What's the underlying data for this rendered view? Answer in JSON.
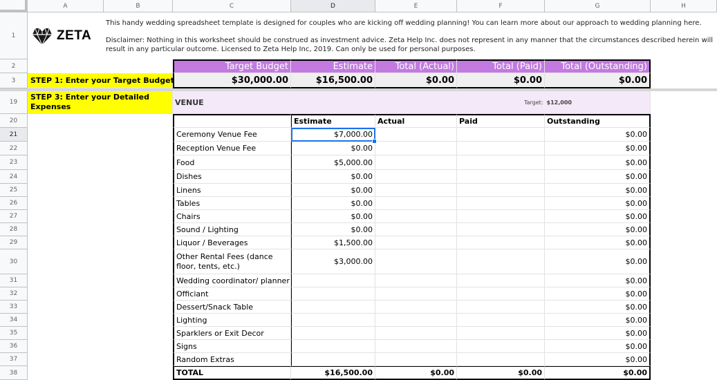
{
  "columns": [
    "A",
    "B",
    "C",
    "D",
    "E",
    "F",
    "G",
    "H"
  ],
  "selected_column": "D",
  "rows": [
    "1",
    "2",
    "3",
    "19",
    "20",
    "21",
    "22",
    "23",
    "24",
    "25",
    "26",
    "27",
    "28",
    "29",
    "30",
    "31",
    "32",
    "33",
    "34",
    "35",
    "36",
    "37",
    "38"
  ],
  "selected_row": "21",
  "logo": {
    "icon": "heart-gem-icon",
    "text": "ZETA"
  },
  "intro_line": "This handy wedding spreadsheet template is designed for couples who are kicking off wedding planning! You can learn more about our approach to wedding planning here.",
  "disclaimer_line1": "Disclaimer: Nothing in this worksheet should be construed as investment advice. Zeta Help Inc. does not represent in any manner that the circumstances described herein will",
  "disclaimer_line2": "result in any particular outcome. Licensed to Zeta Help Inc, 2019. Can only be used for personal purposes.",
  "budget_header": {
    "target": "Target Budget",
    "estimate": "Estimate",
    "total_actual": "Total (Actual)",
    "total_paid": "Total (Paid)",
    "total_outstanding": "Total (Outstanding)"
  },
  "budget_values": {
    "target": "$30,000.00",
    "estimate": "$16,500.00",
    "total_actual": "$0.00",
    "total_paid": "$0.00",
    "total_outstanding": "$0.00"
  },
  "step1_label": "STEP 1: Enter your Target Budget",
  "step3_label": "STEP 3: Enter your Detailed Expenses",
  "section": {
    "title": "VENUE",
    "target_label": "Target:",
    "target_value": "$12,000"
  },
  "table_headers": {
    "estimate": "Estimate",
    "actual": "Actual",
    "paid": "Paid",
    "outstanding": "Outstanding"
  },
  "items": [
    {
      "name": "Ceremony Venue Fee",
      "estimate": "$7,000.00",
      "outstanding": "$0.00"
    },
    {
      "name": "Reception Venue Fee",
      "estimate": "$0.00",
      "outstanding": "$0.00"
    },
    {
      "name": "Food",
      "estimate": "$5,000.00",
      "outstanding": "$0.00"
    },
    {
      "name": "Dishes",
      "estimate": "$0.00",
      "outstanding": "$0.00"
    },
    {
      "name": "Linens",
      "estimate": "$0.00",
      "outstanding": "$0.00"
    },
    {
      "name": "Tables",
      "estimate": "$0.00",
      "outstanding": "$0.00"
    },
    {
      "name": "Chairs",
      "estimate": "$0.00",
      "outstanding": "$0.00"
    },
    {
      "name": "Sound / Lighting",
      "estimate": "$0.00",
      "outstanding": "$0.00"
    },
    {
      "name": "Liquor / Beverages",
      "estimate": "$1,500.00",
      "outstanding": "$0.00"
    },
    {
      "name": "Other Rental Fees (dance",
      "name2": "floor, tents, etc.)",
      "estimate": "$3,000.00",
      "outstanding": "$0.00"
    },
    {
      "name": "Wedding coordinator/ planner",
      "estimate": "",
      "outstanding": "$0.00"
    },
    {
      "name": "Officiant",
      "estimate": "",
      "outstanding": "$0.00"
    },
    {
      "name": "Dessert/Snack Table",
      "estimate": "",
      "outstanding": "$0.00"
    },
    {
      "name": "Lighting",
      "estimate": "",
      "outstanding": "$0.00"
    },
    {
      "name": "Sparklers or Exit Decor",
      "estimate": "",
      "outstanding": "$0.00"
    },
    {
      "name": "Signs",
      "estimate": "",
      "outstanding": "$0.00"
    },
    {
      "name": "Random Extras",
      "estimate": "",
      "outstanding": "$0.00"
    }
  ],
  "total_row": {
    "label": "TOTAL",
    "estimate": "$16,500.00",
    "actual": "$0.00",
    "paid": "$0.00",
    "outstanding": "$0.00"
  },
  "colors": {
    "purple": "#c27ae0",
    "yellow": "#ffff00",
    "selection": "#1a73e8"
  }
}
